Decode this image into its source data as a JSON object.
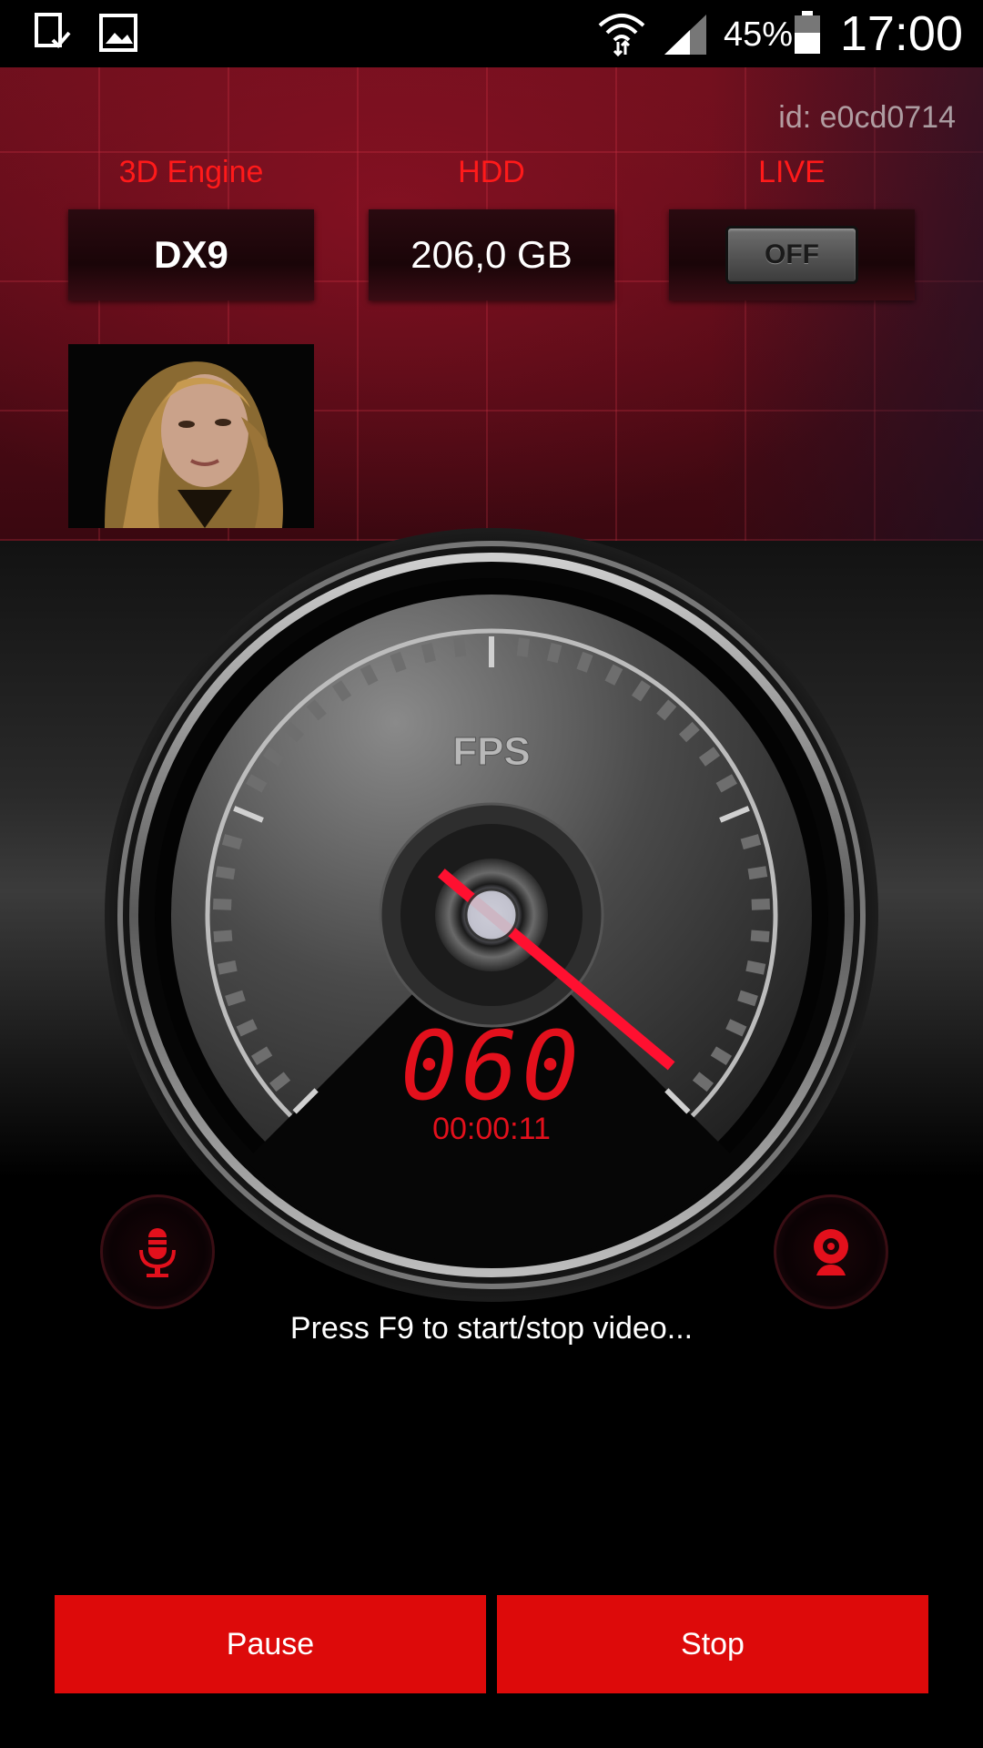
{
  "status_bar": {
    "time": "17:00",
    "battery_percent": "45%",
    "icons": [
      "device-check-icon",
      "image-icon",
      "wifi-icon",
      "signal-icon",
      "battery-icon"
    ]
  },
  "header": {
    "device_id": "id: e0cd0714"
  },
  "info": {
    "engine_label": "3D Engine",
    "engine_value": "DX9",
    "hdd_label": "HDD",
    "hdd_value": "206,0 GB",
    "live_label": "LIVE",
    "live_toggle": "OFF"
  },
  "gauge": {
    "title": "FPS",
    "fps_value": "060",
    "elapsed": "00:00:11"
  },
  "controls": {
    "mic_icon": "microphone-icon",
    "camera_icon": "webcam-icon"
  },
  "hint_text": "Press F9 to start/stop video...",
  "actions": {
    "pause_label": "Pause",
    "stop_label": "Stop"
  },
  "colors": {
    "accent_red": "#dd0a0a",
    "label_red": "#ff1a1a",
    "needle_red": "#ff1030"
  }
}
